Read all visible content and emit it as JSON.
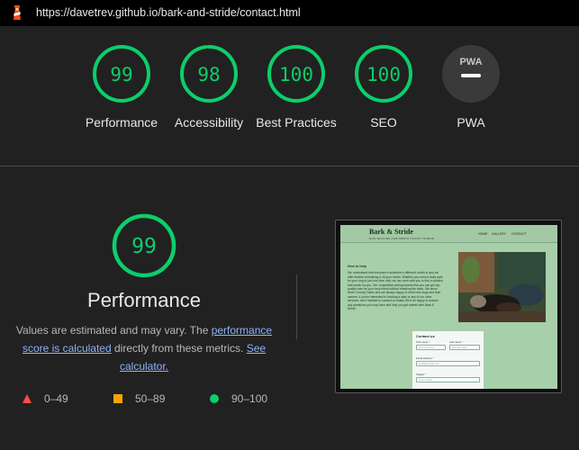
{
  "toolbar": {
    "url": "https://davetrev.github.io/bark-and-stride/contact.html"
  },
  "summary": [
    {
      "score": "99",
      "label": "Performance",
      "pct": 0.99,
      "color": "#0cce6b"
    },
    {
      "score": "98",
      "label": "Accessibility",
      "pct": 0.98,
      "color": "#0cce6b"
    },
    {
      "score": "100",
      "label": "Best Practices",
      "pct": 1.0,
      "color": "#0cce6b"
    },
    {
      "score": "100",
      "label": "SEO",
      "pct": 1.0,
      "color": "#0cce6b"
    },
    {
      "score": "PWA",
      "label": "PWA",
      "pct": 0,
      "color": "#9e9e9e"
    }
  ],
  "performance": {
    "score": "99",
    "pct": 0.99,
    "title": "Performance",
    "desc_prefix": "Values are estimated and may vary. The ",
    "link1": "performance score is calculated",
    "desc_middle": " directly from these metrics. ",
    "link2": "See calculator.",
    "color": "#0cce6b"
  },
  "legend": [
    {
      "range": "0–49",
      "shape": "triangle",
      "color": "#ff4e42"
    },
    {
      "range": "50–89",
      "shape": "square",
      "color": "#ffa400"
    },
    {
      "range": "90–100",
      "shape": "circle",
      "color": "#0cce6b"
    }
  ],
  "screenshot": {
    "brand": "Bark & Stride",
    "tagline": "DOG WALKING FOR NORTH COUNTY DUBLIN",
    "nav": [
      "HOME",
      "GALLERY",
      "CONTACT"
    ],
    "heading": "Here to help",
    "body": "We understand that everyone's schedule is different, which is why we offer flexible scheduling to fit your needs. Whether you need a daily walk for your dog or just one-time visit, we can work with you to find a solution that works for you. Our competitive pricing means that you can get top-quality care for your furry friend without breaking the bank. We serve North County Dublin and are always happy to meet new dogs and their owners. If you're interested in booking a walk or any of our other services, don't hesitate to contact us today! We'd be happy to answer any questions you may have and help you get started with Bark & Stride.",
    "form": {
      "title": "Contact us",
      "first_label": "First name *",
      "first_placeholder": "Enter first name",
      "last_label": "Last name *",
      "last_placeholder": "Enter last name",
      "email_label": "Email address *",
      "email_placeholder": "Email@example.com",
      "subject_label": "Subject *",
      "subject_placeholder": "Select subject"
    }
  }
}
